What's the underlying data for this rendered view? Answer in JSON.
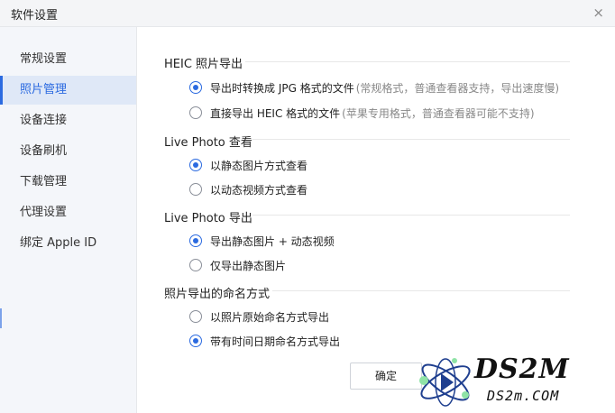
{
  "window": {
    "title": "软件设置",
    "close_glyph": "×"
  },
  "sidebar": {
    "items": [
      {
        "label": "常规设置",
        "active": false
      },
      {
        "label": "照片管理",
        "active": true
      },
      {
        "label": "设备连接",
        "active": false
      },
      {
        "label": "设备刷机",
        "active": false
      },
      {
        "label": "下载管理",
        "active": false
      },
      {
        "label": "代理设置",
        "active": false
      },
      {
        "label": "绑定 Apple ID",
        "active": false
      }
    ]
  },
  "sections": [
    {
      "title": "HEIC 照片导出",
      "options": [
        {
          "label": "导出时转换成 JPG 格式的文件",
          "note": "(常规格式，普通查看器支持，导出速度慢)",
          "checked": true
        },
        {
          "label": "直接导出 HEIC 格式的文件",
          "note": "(苹果专用格式，普通查看器可能不支持)",
          "checked": false
        }
      ]
    },
    {
      "title": "Live Photo 查看",
      "options": [
        {
          "label": "以静态图片方式查看",
          "note": "",
          "checked": true
        },
        {
          "label": "以动态视频方式查看",
          "note": "",
          "checked": false
        }
      ]
    },
    {
      "title": "Live Photo 导出",
      "options": [
        {
          "label": "导出静态图片 + 动态视频",
          "note": "",
          "checked": true
        },
        {
          "label": "仅导出静态图片",
          "note": "",
          "checked": false
        }
      ]
    },
    {
      "title": "照片导出的命名方式",
      "options": [
        {
          "label": "以照片原始命名方式导出",
          "note": "",
          "checked": false
        },
        {
          "label": "带有时间日期命名方式导出",
          "note": "",
          "checked": true
        }
      ]
    }
  ],
  "buttons": {
    "ok": "确定"
  },
  "watermark": {
    "main": "DS2M",
    "sub": "DS2m.COM"
  },
  "colors": {
    "accent": "#2b6ae0",
    "sidebar_bg": "#f4f6fa",
    "active_bg": "#dfe8f7"
  }
}
